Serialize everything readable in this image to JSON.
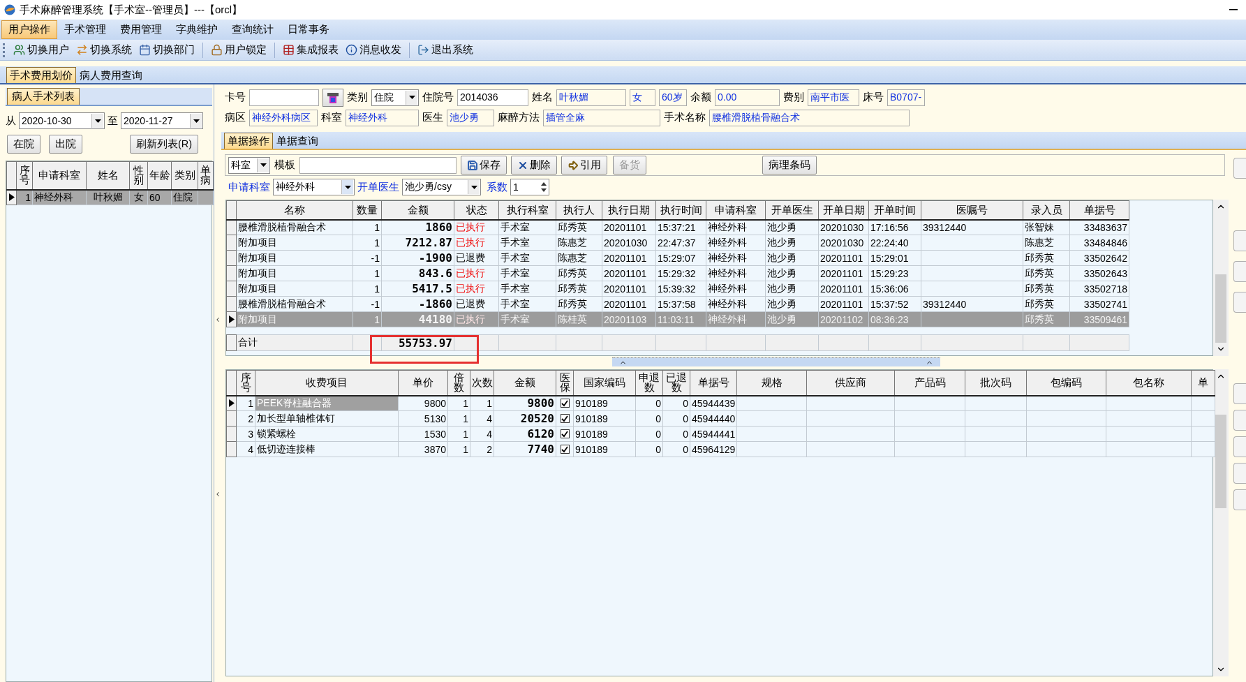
{
  "window": {
    "title": "手术麻醉管理系统【手术室--管理员】---【orcl】"
  },
  "menu": [
    {
      "label": "用户操作",
      "selected": true
    },
    {
      "label": "手术管理",
      "selected": false
    },
    {
      "label": "费用管理",
      "selected": false
    },
    {
      "label": "字典维护",
      "selected": false
    },
    {
      "label": "查询统计",
      "selected": false
    },
    {
      "label": "日常事务",
      "selected": false
    }
  ],
  "toolbar": [
    [
      {
        "label": "切换用户",
        "kind": "users"
      },
      {
        "label": "切换系统",
        "kind": "switch"
      },
      {
        "label": "切换部门",
        "kind": "calendar"
      }
    ],
    [
      {
        "label": "用户锁定",
        "kind": "lock"
      }
    ],
    [
      {
        "label": "集成报表",
        "kind": "report"
      },
      {
        "label": "消息收发",
        "kind": "info"
      }
    ],
    [
      {
        "label": "退出系统",
        "kind": "exit"
      }
    ]
  ],
  "page_tabs": [
    {
      "label": "手术费用划价",
      "selected": true
    },
    {
      "label": "病人费用查询",
      "selected": false
    }
  ],
  "left_panel": {
    "title": "病人手术列表",
    "from_label": "从",
    "from_date": "2020-10-30",
    "to_label": "至",
    "to_date": "2020-11-27",
    "buttons": [
      "在院",
      "出院",
      "刷新列表(R)"
    ],
    "columns": [
      "序号",
      "申请科室",
      "姓名",
      "性别",
      "年龄",
      "类别",
      "单病"
    ],
    "rows": [
      {
        "no": "1",
        "dept": "神经外科",
        "name": "叶秋媚",
        "sex": "女",
        "age": "60",
        "type": "住院",
        "selected": true
      }
    ]
  },
  "patient": {
    "first_line": [
      {
        "label": "卡号",
        "kind": "input"
      },
      {
        "kind": "button"
      },
      {
        "label": "类别",
        "value": "住院",
        "kind": "select"
      },
      {
        "label": "住院号",
        "value": "2014036",
        "kind": "input"
      },
      {
        "label": "姓名",
        "value": "叶秋媚",
        "kind": "display"
      },
      {
        "value": "女",
        "kind": "display"
      },
      {
        "value": "60岁",
        "kind": "display"
      },
      {
        "label": "余额",
        "value": "0.00",
        "kind": "display"
      },
      {
        "label": "费别",
        "value": "南平市医",
        "kind": "display"
      },
      {
        "label": "床号",
        "value": "B0707-",
        "kind": "display"
      }
    ],
    "second_line": [
      {
        "label": "病区",
        "value": "神经外科病区",
        "kind": "display"
      },
      {
        "label": "科室",
        "value": "神经外科",
        "kind": "display"
      },
      {
        "label": "医生",
        "value": "池少勇",
        "kind": "display"
      },
      {
        "label": "麻醉方法",
        "value": "插管全麻",
        "kind": "display"
      },
      {
        "label": "手术名称",
        "value": "腰椎滑脱植骨融合术",
        "kind": "display"
      }
    ]
  },
  "inner_tabs": [
    {
      "label": "单据操作",
      "selected": true
    },
    {
      "label": "单据查询",
      "selected": false
    }
  ],
  "action_bar": {
    "scope": "科室",
    "template_label": "模板",
    "buttons": [
      {
        "label": "保存",
        "kind": "save",
        "disabled": false
      },
      {
        "label": "删除",
        "kind": "delete",
        "disabled": false
      },
      {
        "label": "引用",
        "kind": "quote",
        "disabled": false
      },
      {
        "label": "备货",
        "kind": "plain",
        "disabled": true
      }
    ],
    "barcode_button": "病理条码"
  },
  "order_bar": {
    "dept_label": "申请科室",
    "dept": "神经外科",
    "doctor_label": "开单医生",
    "doctor": "池少勇/csy",
    "factor_label": "系数",
    "factor": "1"
  },
  "orders_table": {
    "columns": [
      "名称",
      "数量",
      "金额",
      "状态",
      "执行科室",
      "执行人",
      "执行日期",
      "执行时间",
      "申请科室",
      "开单医生",
      "开单日期",
      "开单时间",
      "医嘱号",
      "录入员",
      "单据号"
    ],
    "rows": [
      {
        "name": "腰椎滑脱植骨融合术",
        "qty": "1",
        "amount": "1860",
        "status": "已执行",
        "executed": true,
        "exec_dept": "手术室",
        "executor": "邱秀英",
        "exec_date": "20201101",
        "exec_time": "15:37:21",
        "req_dept": "神经外科",
        "doctor": "池少勇",
        "order_date": "20201030",
        "order_time": "17:16:56",
        "order_no": "39312440",
        "entered_by": "张智妹",
        "bill_no": "33483637",
        "selected": false
      },
      {
        "name": "附加项目",
        "qty": "1",
        "amount": "7212.87",
        "status": "已执行",
        "executed": true,
        "exec_dept": "手术室",
        "executor": "陈惠芝",
        "exec_date": "20201030",
        "exec_time": "22:47:37",
        "req_dept": "神经外科",
        "doctor": "池少勇",
        "order_date": "20201030",
        "order_time": "22:24:40",
        "order_no": null,
        "entered_by": "陈惠芝",
        "bill_no": "33484846",
        "selected": false
      },
      {
        "name": "附加项目",
        "qty": "-1",
        "amount": "-1900",
        "status": "已退费",
        "executed": false,
        "exec_dept": "手术室",
        "executor": "陈惠芝",
        "exec_date": "20201101",
        "exec_time": "15:29:07",
        "req_dept": "神经外科",
        "doctor": "池少勇",
        "order_date": "20201101",
        "order_time": "15:29:01",
        "order_no": null,
        "entered_by": "邱秀英",
        "bill_no": "33502642",
        "selected": false
      },
      {
        "name": "附加项目",
        "qty": "1",
        "amount": "843.6",
        "status": "已执行",
        "executed": true,
        "exec_dept": "手术室",
        "executor": "邱秀英",
        "exec_date": "20201101",
        "exec_time": "15:29:32",
        "req_dept": "神经外科",
        "doctor": "池少勇",
        "order_date": "20201101",
        "order_time": "15:29:23",
        "order_no": null,
        "entered_by": "邱秀英",
        "bill_no": "33502643",
        "selected": false
      },
      {
        "name": "附加项目",
        "qty": "1",
        "amount": "5417.5",
        "status": "已执行",
        "executed": true,
        "exec_dept": "手术室",
        "executor": "邱秀英",
        "exec_date": "20201101",
        "exec_time": "15:39:32",
        "req_dept": "神经外科",
        "doctor": "池少勇",
        "order_date": "20201101",
        "order_time": "15:36:06",
        "order_no": null,
        "entered_by": "邱秀英",
        "bill_no": "33502718",
        "selected": false
      },
      {
        "name": "腰椎滑脱植骨融合术",
        "qty": "-1",
        "amount": "-1860",
        "status": "已退费",
        "executed": false,
        "exec_dept": "手术室",
        "executor": "邱秀英",
        "exec_date": "20201101",
        "exec_time": "15:37:58",
        "req_dept": "神经外科",
        "doctor": "池少勇",
        "order_date": "20201101",
        "order_time": "15:37:52",
        "order_no": "39312440",
        "entered_by": "邱秀英",
        "bill_no": "33502741",
        "selected": false
      },
      {
        "name": "附加项目",
        "qty": "1",
        "amount": "44180",
        "status": "已执行",
        "executed": true,
        "exec_dept": "手术室",
        "executor": "陈桂英",
        "exec_date": "20201103",
        "exec_time": "11:03:11",
        "req_dept": "神经外科",
        "doctor": "池少勇",
        "order_date": "20201102",
        "order_time": "08:36:23",
        "order_no": null,
        "entered_by": "邱秀英",
        "bill_no": "33509461",
        "selected": true
      }
    ],
    "total": {
      "label": "合计",
      "amount": "55753.97",
      "highlighted": true
    }
  },
  "items_table": {
    "columns": [
      "序号",
      "收费项目",
      "单价",
      "倍数",
      "次数",
      "金额",
      "医保",
      "国家编码",
      "申退数",
      "已退数",
      "单据号",
      "规格",
      "供应商",
      "产品码",
      "批次码",
      "包编码",
      "包名称",
      "单"
    ],
    "rows": [
      {
        "no": "1",
        "item": "PEEK脊柱融合器",
        "price": "9800",
        "multiple": "1",
        "times": "1",
        "amount": "9800",
        "insured": true,
        "code": "910189",
        "req_refund": "0",
        "refunded": "0",
        "bill_no": "45944439",
        "selected": true
      },
      {
        "no": "2",
        "item": "加长型单轴椎体钉",
        "price": "5130",
        "multiple": "1",
        "times": "4",
        "amount": "20520",
        "insured": true,
        "code": "910189",
        "req_refund": "0",
        "refunded": "0",
        "bill_no": "45944440",
        "selected": false
      },
      {
        "no": "3",
        "item": "锁紧螺栓",
        "price": "1530",
        "multiple": "1",
        "times": "4",
        "amount": "6120",
        "insured": true,
        "code": "910189",
        "req_refund": "0",
        "refunded": "0",
        "bill_no": "45944441",
        "selected": false
      },
      {
        "no": "4",
        "item": "低切迹连接棒",
        "price": "3870",
        "multiple": "1",
        "times": "2",
        "amount": "7740",
        "insured": true,
        "code": "910189",
        "req_refund": "0",
        "refunded": "0",
        "bill_no": "45964129",
        "selected": false
      }
    ]
  }
}
